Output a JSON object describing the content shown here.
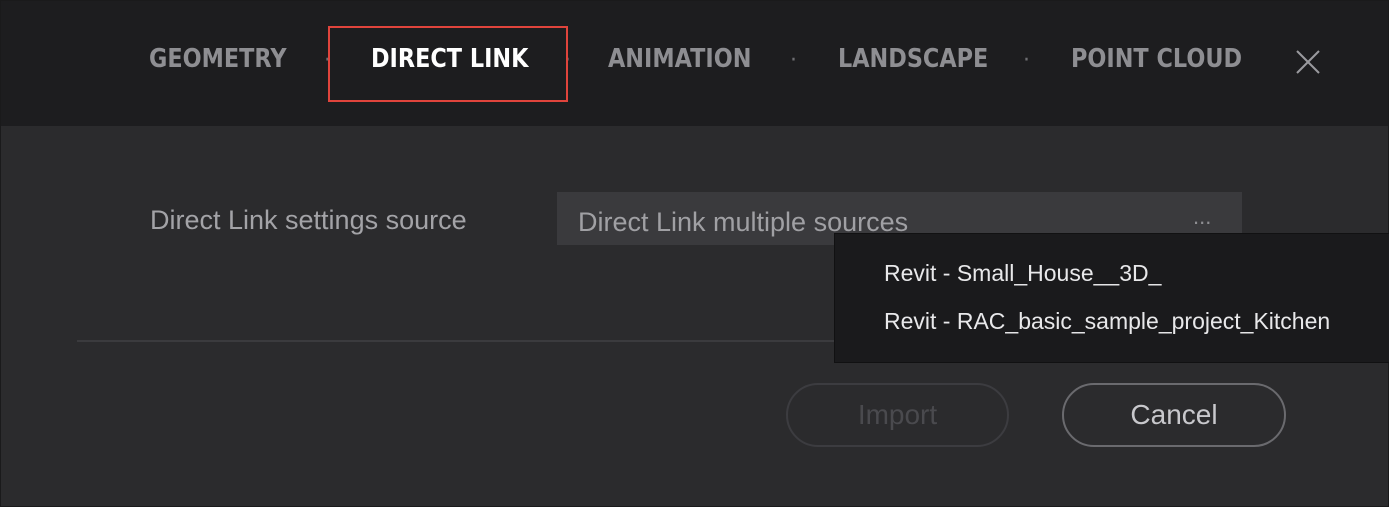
{
  "tabs": [
    {
      "label": "GEOMETRY",
      "active": false
    },
    {
      "label": "DIRECT LINK",
      "active": true
    },
    {
      "label": "ANIMATION",
      "active": false
    },
    {
      "label": "LANDSCAPE",
      "active": false
    },
    {
      "label": "POINT CLOUD",
      "active": false
    }
  ],
  "separator": "·",
  "close_icon": "close-icon",
  "settings": {
    "label": "Direct Link settings source",
    "value": "Direct Link multiple sources",
    "more": "..."
  },
  "dropdown": {
    "items": [
      "Revit - Small_House__3D_",
      "Revit - RAC_basic_sample_project_Kitchen"
    ]
  },
  "buttons": {
    "import": "Import",
    "cancel": "Cancel"
  },
  "colors": {
    "highlight": "#e0443c",
    "tab_active": "#ffffff",
    "tab_inactive": "#8e8e92"
  }
}
